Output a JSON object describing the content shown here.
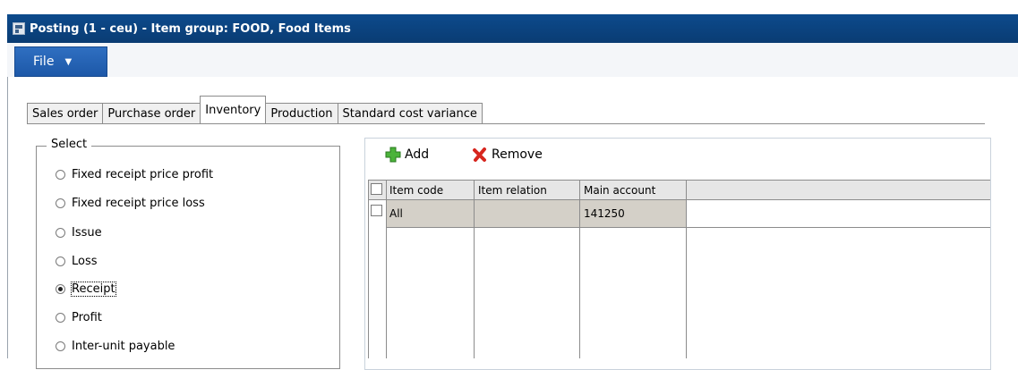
{
  "window": {
    "title": "Posting (1 - ceu) - Item group: FOOD, Food Items"
  },
  "ribbon": {
    "file_label": "File"
  },
  "tabs": [
    {
      "label": "Sales order"
    },
    {
      "label": "Purchase order"
    },
    {
      "label": "Inventory",
      "active": true
    },
    {
      "label": "Production"
    },
    {
      "label": "Standard cost variance"
    }
  ],
  "select": {
    "legend": "Select",
    "options": [
      {
        "label": "Fixed receipt price profit",
        "checked": false
      },
      {
        "label": "Fixed receipt price loss",
        "checked": false
      },
      {
        "label": "Issue",
        "checked": false
      },
      {
        "label": "Loss",
        "checked": false
      },
      {
        "label": "Receipt",
        "checked": true
      },
      {
        "label": "Profit",
        "checked": false
      },
      {
        "label": "Inter-unit payable",
        "checked": false
      }
    ]
  },
  "toolbar": {
    "add_label": "Add",
    "remove_label": "Remove",
    "add_icon": "add-icon",
    "remove_icon": "remove-icon"
  },
  "grid": {
    "columns": [
      "Item code",
      "Item relation",
      "Main account"
    ],
    "rows": [
      {
        "item_code": "All",
        "item_relation": "",
        "main_account": "141250"
      }
    ]
  },
  "colors": {
    "title_bar": "#0c4a8c",
    "file_button": "#1d58a8",
    "header_bg": "#e6e6e6",
    "row_bg": "#d4d0c8"
  }
}
